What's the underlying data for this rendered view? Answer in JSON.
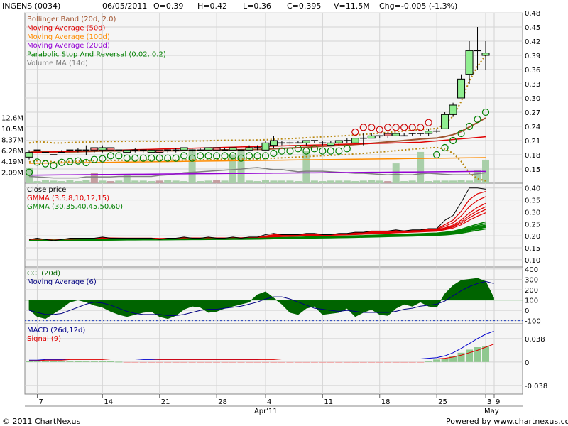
{
  "header": {
    "symbol": "INGENS (0034)",
    "date": "06/05/2011",
    "open": "O=0.39",
    "high": "H=0.42",
    "low": "L=0.36",
    "close": "C=0.395",
    "volume": "V=11.5M",
    "change": "Chg=-0.005 (-1.3%)"
  },
  "footer": {
    "copyright": "© 2011 ChartNexus",
    "powered": "Powered by www.chartnexus.com"
  },
  "chart_data": [
    {
      "type": "candlestick",
      "panel": "price",
      "legend": [
        {
          "label": "Bollinger Band (20d, 2.0)",
          "color": "#a0522d"
        },
        {
          "label": "Moving Average (50d)",
          "color": "#e00000"
        },
        {
          "label": "Moving Average (100d)",
          "color": "#ff8c00"
        },
        {
          "label": "Moving Average (200d)",
          "color": "#9400d3"
        },
        {
          "label": "Parabolic Stop And Reversal (0.02, 0.2)",
          "color": "#008000"
        },
        {
          "label": "Volume MA (14d)",
          "color": "#808080"
        }
      ],
      "y_ticks": [
        "0.48",
        "0.45",
        "0.42",
        "0.39",
        "0.36",
        "0.33",
        "0.30",
        "0.27",
        "0.24",
        "0.21",
        "0.18",
        "0.15"
      ],
      "ylim": [
        0.12,
        0.48
      ],
      "volume_ticks": [
        "12.6M",
        "10.5M",
        "8.37M",
        "6.28M",
        "4.19M",
        "2.09M"
      ],
      "volume_lim": [
        0,
        14.7
      ],
      "x_ticks": [
        "7",
        "14",
        "21",
        "28",
        "4",
        "11",
        "18",
        "25",
        "3",
        "9"
      ],
      "x_month_labels": [
        "Apr'11",
        "May"
      ],
      "candles": [
        {
          "o": 0.175,
          "h": 0.19,
          "l": 0.17,
          "c": 0.185
        },
        {
          "o": 0.19,
          "h": 0.19,
          "l": 0.19,
          "c": 0.19
        },
        {
          "o": 0.185,
          "h": 0.185,
          "l": 0.185,
          "c": 0.185
        },
        {
          "o": 0.18,
          "h": 0.18,
          "l": 0.18,
          "c": 0.18
        },
        {
          "o": 0.185,
          "h": 0.19,
          "l": 0.185,
          "c": 0.185
        },
        {
          "o": 0.19,
          "h": 0.19,
          "l": 0.185,
          "c": 0.19
        },
        {
          "o": 0.19,
          "h": 0.195,
          "l": 0.185,
          "c": 0.19
        },
        {
          "o": 0.19,
          "h": 0.2,
          "l": 0.18,
          "c": 0.19
        },
        {
          "o": 0.195,
          "h": 0.195,
          "l": 0.185,
          "c": 0.19
        },
        {
          "o": 0.19,
          "h": 0.2,
          "l": 0.185,
          "c": 0.195
        },
        {
          "o": 0.195,
          "h": 0.195,
          "l": 0.19,
          "c": 0.19
        },
        {
          "o": 0.19,
          "h": 0.19,
          "l": 0.19,
          "c": 0.19
        },
        {
          "o": 0.185,
          "h": 0.19,
          "l": 0.185,
          "c": 0.19
        },
        {
          "o": 0.19,
          "h": 0.195,
          "l": 0.185,
          "c": 0.19
        },
        {
          "o": 0.19,
          "h": 0.19,
          "l": 0.185,
          "c": 0.19
        },
        {
          "o": 0.185,
          "h": 0.19,
          "l": 0.185,
          "c": 0.19
        },
        {
          "o": 0.19,
          "h": 0.19,
          "l": 0.185,
          "c": 0.185
        },
        {
          "o": 0.19,
          "h": 0.19,
          "l": 0.185,
          "c": 0.19
        },
        {
          "o": 0.19,
          "h": 0.195,
          "l": 0.185,
          "c": 0.19
        },
        {
          "o": 0.19,
          "h": 0.195,
          "l": 0.19,
          "c": 0.195
        },
        {
          "o": 0.19,
          "h": 0.195,
          "l": 0.185,
          "c": 0.19
        },
        {
          "o": 0.19,
          "h": 0.195,
          "l": 0.19,
          "c": 0.19
        },
        {
          "o": 0.19,
          "h": 0.195,
          "l": 0.19,
          "c": 0.195
        },
        {
          "o": 0.195,
          "h": 0.195,
          "l": 0.19,
          "c": 0.19
        },
        {
          "o": 0.19,
          "h": 0.195,
          "l": 0.19,
          "c": 0.19
        },
        {
          "o": 0.19,
          "h": 0.195,
          "l": 0.19,
          "c": 0.195
        },
        {
          "o": 0.19,
          "h": 0.2,
          "l": 0.185,
          "c": 0.19
        },
        {
          "o": 0.19,
          "h": 0.2,
          "l": 0.19,
          "c": 0.195
        },
        {
          "o": 0.195,
          "h": 0.2,
          "l": 0.19,
          "c": 0.195
        },
        {
          "o": 0.19,
          "h": 0.21,
          "l": 0.19,
          "c": 0.205
        },
        {
          "o": 0.2,
          "h": 0.22,
          "l": 0.195,
          "c": 0.21
        },
        {
          "o": 0.205,
          "h": 0.21,
          "l": 0.2,
          "c": 0.205
        },
        {
          "o": 0.205,
          "h": 0.21,
          "l": 0.2,
          "c": 0.205
        },
        {
          "o": 0.205,
          "h": 0.21,
          "l": 0.205,
          "c": 0.205
        },
        {
          "o": 0.205,
          "h": 0.21,
          "l": 0.2,
          "c": 0.21
        },
        {
          "o": 0.21,
          "h": 0.21,
          "l": 0.205,
          "c": 0.21
        },
        {
          "o": 0.205,
          "h": 0.21,
          "l": 0.2,
          "c": 0.205
        },
        {
          "o": 0.2,
          "h": 0.21,
          "l": 0.2,
          "c": 0.205
        },
        {
          "o": 0.205,
          "h": 0.21,
          "l": 0.2,
          "c": 0.21
        },
        {
          "o": 0.21,
          "h": 0.215,
          "l": 0.205,
          "c": 0.21
        },
        {
          "o": 0.205,
          "h": 0.215,
          "l": 0.205,
          "c": 0.215
        },
        {
          "o": 0.215,
          "h": 0.225,
          "l": 0.2,
          "c": 0.215
        },
        {
          "o": 0.215,
          "h": 0.225,
          "l": 0.215,
          "c": 0.22
        },
        {
          "o": 0.22,
          "h": 0.22,
          "l": 0.215,
          "c": 0.22
        },
        {
          "o": 0.225,
          "h": 0.225,
          "l": 0.215,
          "c": 0.22
        },
        {
          "o": 0.22,
          "h": 0.225,
          "l": 0.22,
          "c": 0.225
        },
        {
          "o": 0.22,
          "h": 0.225,
          "l": 0.22,
          "c": 0.22
        },
        {
          "o": 0.225,
          "h": 0.225,
          "l": 0.22,
          "c": 0.225
        },
        {
          "o": 0.225,
          "h": 0.225,
          "l": 0.22,
          "c": 0.225
        },
        {
          "o": 0.225,
          "h": 0.235,
          "l": 0.22,
          "c": 0.23
        },
        {
          "o": 0.23,
          "h": 0.235,
          "l": 0.225,
          "c": 0.23
        },
        {
          "o": 0.235,
          "h": 0.27,
          "l": 0.235,
          "c": 0.265
        },
        {
          "o": 0.265,
          "h": 0.29,
          "l": 0.26,
          "c": 0.285
        },
        {
          "o": 0.3,
          "h": 0.35,
          "l": 0.3,
          "c": 0.34
        },
        {
          "o": 0.35,
          "h": 0.42,
          "l": 0.33,
          "c": 0.4
        },
        {
          "o": 0.4,
          "h": 0.45,
          "l": 0.36,
          "c": 0.4
        },
        {
          "o": 0.39,
          "h": 0.42,
          "l": 0.36,
          "c": 0.395
        }
      ],
      "volumes": [
        3.0,
        0.4,
        0.6,
        0.5,
        0.4,
        0.6,
        0.4,
        0.6,
        2.0,
        0.5,
        0.4,
        0.5,
        1.5,
        0.5,
        0.5,
        0.4,
        0.5,
        0.6,
        0.5,
        0.4,
        6.5,
        0.4,
        0.5,
        0.6,
        0.5,
        5.5,
        6.5,
        0.5,
        0.4,
        0.6,
        0.5,
        0.5,
        0.5,
        0.4,
        6.2,
        0.5,
        0.4,
        0.5,
        0.5,
        0.5,
        0.4,
        0.5,
        0.6,
        0.5,
        0.4,
        3.8,
        0.4,
        0.5,
        6.0,
        0.4,
        0.5,
        0.5,
        0.5,
        0.6,
        0.5,
        2.5,
        4.5,
        8.2,
        13.5,
        11.5
      ],
      "vol_ma14": [
        1.3,
        1.2,
        1.1,
        1.0,
        1.0,
        1.0,
        1.0,
        1.2,
        1.2,
        1.2,
        1.2,
        1.3,
        1.3,
        1.3,
        1.3,
        1.3,
        1.5,
        1.6,
        1.8,
        2.0,
        2.1,
        2.2,
        2.3,
        2.4,
        2.5,
        2.6,
        2.7,
        2.9,
        3.0,
        2.8,
        2.6,
        2.6,
        2.4,
        2.2,
        2.3,
        2.3,
        2.3,
        2.2,
        2.1,
        2.0,
        1.9,
        1.9,
        1.8,
        1.7,
        1.6,
        1.7,
        1.6,
        1.6,
        1.8,
        1.9,
        1.8,
        1.7,
        1.6,
        1.6,
        1.6,
        1.8,
        2.0,
        2.8,
        3.8,
        4.6
      ]
    },
    {
      "type": "line",
      "panel": "gmma",
      "legend": [
        {
          "label": "Close price",
          "color": "#000000"
        },
        {
          "label": "GMMA (3,5,8,10,12,15)",
          "color": "#e00000"
        },
        {
          "label": "GMMA (30,35,40,45,50,60)",
          "color": "#008000"
        }
      ],
      "y_ticks": [
        "0.40",
        "0.35",
        "0.30",
        "0.25",
        "0.20",
        "0.15",
        "0.10"
      ],
      "ylim": [
        0.07,
        0.42
      ]
    },
    {
      "type": "area",
      "panel": "cci",
      "legend": [
        {
          "label": "CCI (20d)",
          "color": "#006400"
        },
        {
          "label": "Moving Average (6)",
          "color": "#000080"
        }
      ],
      "y_ticks": [
        "400",
        "300",
        "200",
        "100",
        "0",
        "-100"
      ],
      "ylim": [
        -130,
        420
      ],
      "cci": [
        10,
        -60,
        -80,
        -30,
        20,
        80,
        100,
        80,
        50,
        30,
        -10,
        -40,
        -60,
        -40,
        -20,
        -10,
        -60,
        -80,
        -50,
        10,
        40,
        30,
        -20,
        -10,
        20,
        40,
        60,
        80,
        150,
        180,
        120,
        60,
        -20,
        -40,
        20,
        40,
        -40,
        -30,
        -20,
        20,
        -60,
        -20,
        10,
        -40,
        -50,
        20,
        60,
        40,
        80,
        40,
        30,
        160,
        240,
        290,
        300,
        310,
        280,
        120
      ],
      "cci_ma6": [
        0,
        -20,
        -40,
        -40,
        -30,
        0,
        30,
        60,
        80,
        70,
        50,
        20,
        -10,
        -30,
        -40,
        -40,
        -40,
        -50,
        -50,
        -40,
        -20,
        0,
        10,
        10,
        20,
        30,
        40,
        60,
        80,
        110,
        130,
        130,
        110,
        80,
        50,
        20,
        10,
        0,
        -10,
        0,
        -10,
        -20,
        -20,
        -20,
        -20,
        -10,
        10,
        20,
        40,
        50,
        60,
        90,
        140,
        190,
        230,
        260,
        280,
        260
      ]
    },
    {
      "type": "bar",
      "panel": "macd",
      "legend": [
        {
          "label": "MACD (26d,12d)",
          "color": "#00008b"
        },
        {
          "label": "Signal (9)",
          "color": "#e00000"
        }
      ],
      "y_ticks": [
        "0.038",
        "0",
        "-0.038"
      ],
      "ylim": [
        -0.052,
        0.062
      ],
      "macd": [
        0.003,
        0.003,
        0.004,
        0.004,
        0.004,
        0.005,
        0.005,
        0.005,
        0.005,
        0.005,
        0.005,
        0.005,
        0.005,
        0.005,
        0.004,
        0.004,
        0.004,
        0.004,
        0.004,
        0.004,
        0.004,
        0.004,
        0.004,
        0.004,
        0.004,
        0.004,
        0.004,
        0.004,
        0.004,
        0.005,
        0.005,
        0.005,
        0.005,
        0.005,
        0.005,
        0.005,
        0.005,
        0.005,
        0.005,
        0.005,
        0.005,
        0.005,
        0.005,
        0.005,
        0.005,
        0.005,
        0.005,
        0.005,
        0.005,
        0.006,
        0.007,
        0.01,
        0.015,
        0.022,
        0.03,
        0.038,
        0.045,
        0.05
      ],
      "signal": [
        0.002,
        0.002,
        0.003,
        0.003,
        0.003,
        0.004,
        0.004,
        0.004,
        0.004,
        0.004,
        0.005,
        0.005,
        0.005,
        0.005,
        0.005,
        0.005,
        0.004,
        0.004,
        0.004,
        0.004,
        0.004,
        0.004,
        0.004,
        0.004,
        0.004,
        0.004,
        0.004,
        0.004,
        0.004,
        0.004,
        0.004,
        0.005,
        0.005,
        0.005,
        0.005,
        0.005,
        0.005,
        0.005,
        0.005,
        0.005,
        0.005,
        0.005,
        0.005,
        0.005,
        0.005,
        0.005,
        0.005,
        0.005,
        0.005,
        0.005,
        0.005,
        0.006,
        0.008,
        0.011,
        0.015,
        0.019,
        0.024,
        0.029
      ],
      "histogram": [
        0.001,
        0.0015,
        0.001,
        0.001,
        0.0015,
        0.0015,
        0.001,
        0.0012,
        0.0012,
        0.001,
        0.001,
        0.0005,
        -0.0005,
        -0.0006,
        -0.0005,
        -0.0004,
        -0.0006,
        -0.0004,
        -0.0005,
        -0.0004,
        -0.0005,
        -0.0004,
        -0.0005,
        -0.0006,
        -0.0004,
        -0.0005,
        -0.0004,
        -0.0005,
        -0.0004,
        -0.0005,
        -0.0004,
        -0.0005,
        -0.0004,
        -0.0005,
        -0.0004,
        -0.0005,
        -0.0004,
        -0.0005,
        -0.0004,
        -0.0005,
        -0.0004,
        -0.0005,
        -0.0004,
        -0.0005,
        -0.0004,
        -0.0005,
        -0.0004,
        -0.0005,
        -0.0004,
        0.002,
        0.004,
        0.006,
        0.01,
        0.015,
        0.02,
        0.024,
        0.025,
        0.022
      ]
    }
  ]
}
